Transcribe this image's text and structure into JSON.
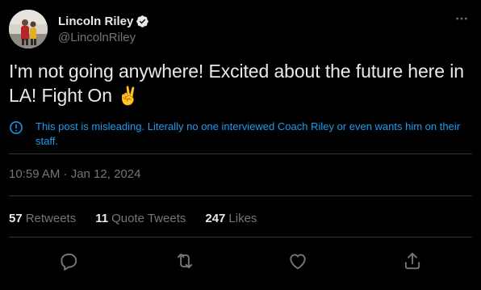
{
  "author": {
    "display_name": "Lincoln Riley",
    "handle": "@LincolnRiley"
  },
  "tweet": {
    "text": "I'm not going anywhere! Excited about the future here in LA! Fight On",
    "emoji": "✌️",
    "timestamp": "10:59 AM · Jan 12, 2024"
  },
  "notice": {
    "text": "This post is misleading. Literally no one interviewed Coach Riley or even wants him on their staff."
  },
  "stats": {
    "retweets_count": "57",
    "retweets_label": "Retweets",
    "quotes_count": "11",
    "quotes_label": "Quote Tweets",
    "likes_count": "247",
    "likes_label": "Likes"
  },
  "colors": {
    "background": "#000000",
    "text_primary": "#e7e9ea",
    "text_secondary": "#71767b",
    "accent_blue": "#1d9bf0",
    "divider": "#2f3336"
  },
  "icons": {
    "verified": "verified-badge-icon",
    "more": "more-dots-icon",
    "notice": "info-icon",
    "reply": "reply-icon",
    "retweet": "retweet-icon",
    "like": "heart-icon",
    "share": "share-icon"
  }
}
